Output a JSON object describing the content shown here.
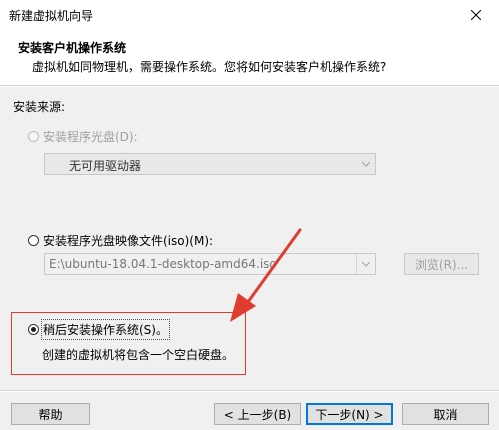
{
  "window": {
    "title": "新建虚拟机向导"
  },
  "header": {
    "title": "安装客户机操作系统",
    "subtitle": "虚拟机如同物理机，需要操作系统。您将如何安装客户机操作系统?"
  },
  "source": {
    "label": "安装来源:",
    "disc": {
      "label": "安装程序光盘(D):",
      "drive_value": "无可用驱动器"
    },
    "iso": {
      "label": "安装程序光盘映像文件(iso)(M):",
      "path_value": "E:\\ubuntu-18.04.1-desktop-amd64.iso",
      "browse_label": "浏览(R)..."
    },
    "later": {
      "label": "稍后安装操作系统(S)。",
      "description": "创建的虚拟机将包含一个空白硬盘。"
    }
  },
  "footer": {
    "help_label": "帮助",
    "back_label": "< 上一步(B)",
    "next_label": "下一步(N) >",
    "cancel_label": "取消"
  },
  "colors": {
    "annotation_red": "#e03c31",
    "focus_blue": "#0078d7"
  }
}
